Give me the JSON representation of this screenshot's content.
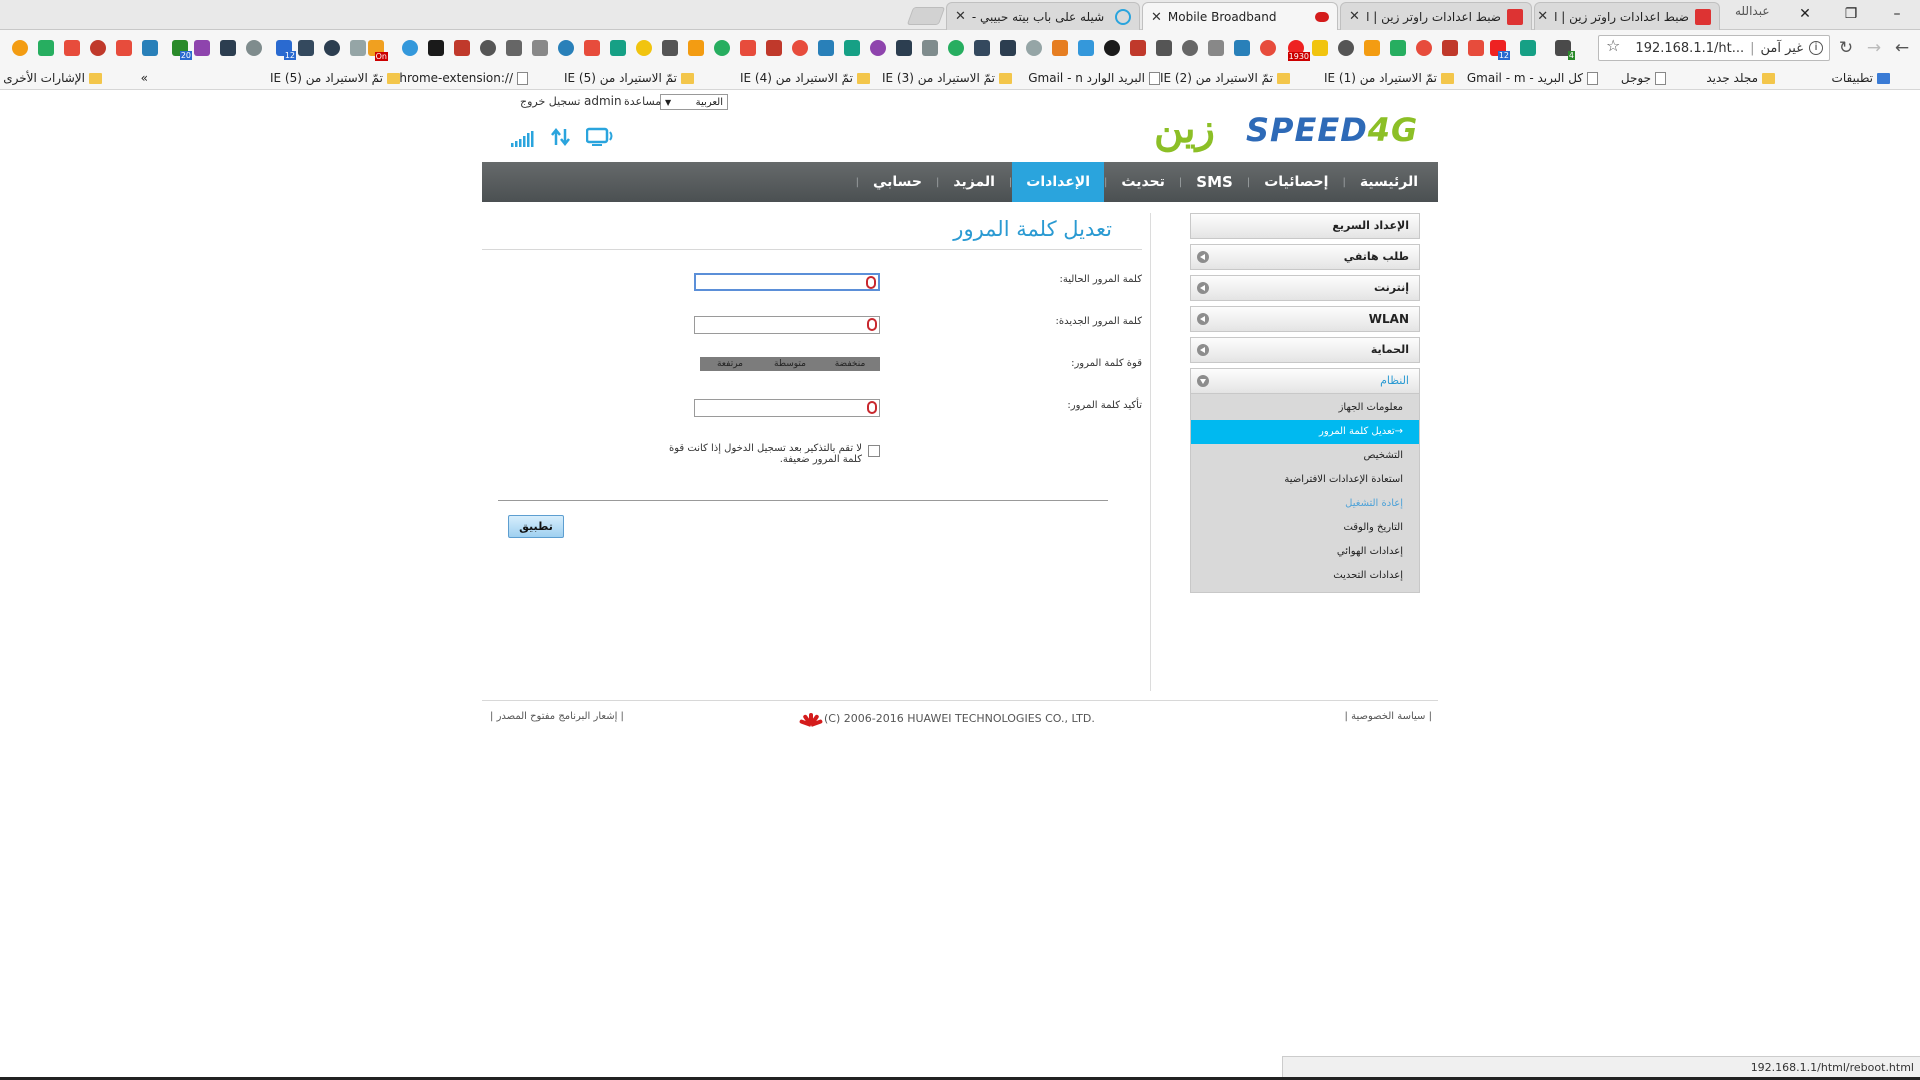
{
  "browser": {
    "profile_name": "عبدالله",
    "tabs": [
      {
        "title": "ضبط اعدادات راوتر زين | ا"
      },
      {
        "title": "ضبط اعدادات راوتر زين | ا"
      },
      {
        "title": "Mobile Broadband"
      },
      {
        "title": "شيله على باب بيته حبيبي -"
      }
    ],
    "omnibox": {
      "security_label": "غير آمن",
      "url": "192.168.1.1/ht..."
    },
    "extension_badges": [
      "20",
      "12",
      "12",
      "4",
      "1930",
      "On"
    ],
    "bookmarks": [
      {
        "label": "تطبيقات"
      },
      {
        "label": "مجلد جديد"
      },
      {
        "label": "جوجل"
      },
      {
        "label": "كل البريد - Gmail - m"
      },
      {
        "label": "تمّ الاستيراد من IE (1)"
      },
      {
        "label": "تمّ الاستيراد من IE (2)"
      },
      {
        "label": "البريد الوارد Gmail - n"
      },
      {
        "label": "تمّ الاستيراد من IE (3)"
      },
      {
        "label": "تمّ الاستيراد من IE (4)"
      },
      {
        "label": "تمّ الاستيراد من IE (5)"
      },
      {
        "label": "//:chrome-extension"
      },
      {
        "label": "تمّ الاستيراد من IE (5)"
      },
      {
        "label": "»"
      },
      {
        "label": "الإشارات الأخرى"
      }
    ],
    "status_url": "192.168.1.1/html/reboot.html"
  },
  "header": {
    "language": "العربية",
    "user": "admin",
    "help": "مساعدة",
    "logout": "تسجيل خروج",
    "logo_zain": "زين",
    "logo_speed": "SPEED",
    "logo_4g": "4G"
  },
  "nav": {
    "items": [
      {
        "label": "الرئيسية"
      },
      {
        "label": "إحصائيات"
      },
      {
        "label": "SMS"
      },
      {
        "label": "تحديث"
      },
      {
        "label": "الإعدادات"
      },
      {
        "label": "المزيد"
      },
      {
        "label": "حسابي"
      }
    ],
    "active_index": 4
  },
  "main": {
    "title": "تعديل كلمة المرور",
    "fields": {
      "current_password_label": "كلمة المرور الحالية:",
      "new_password_label": "كلمة المرور الجديدة:",
      "strength_label": "قوة كلمة المرور:",
      "confirm_password_label": "تأكيد كلمة المرور:"
    },
    "strength_levels": [
      "منخفضة",
      "متوسطة",
      "مرتفعة"
    ],
    "weak_reminder": "لا تقم بالتذكير بعد تسجيل الدخول إذا كانت قوة كلمة المرور ضعيفة.",
    "apply_label": "تطبيق"
  },
  "sidebar": {
    "items": [
      {
        "label": "الإعداد السريع"
      },
      {
        "label": "طلب هاتفي"
      },
      {
        "label": "إنترنت"
      },
      {
        "label": "WLAN"
      },
      {
        "label": "الحماية"
      },
      {
        "label": "النظام"
      }
    ],
    "system_sub": [
      {
        "label": "معلومات الجهاز"
      },
      {
        "label": "تعديل كلمة المرور"
      },
      {
        "label": "التشخيص"
      },
      {
        "label": "استعادة الإعدادات الافتراضية"
      },
      {
        "label": "إعادة التشغيل"
      },
      {
        "label": "التاريخ والوقت"
      },
      {
        "label": "إعدادات الهوائي"
      },
      {
        "label": "إعدادات التحديث"
      }
    ]
  },
  "footer": {
    "privacy": "سياسة الخصوصية",
    "copyright": "(C) 2006-2016 HUAWEI TECHNOLOGIES CO., LTD.",
    "open_source": "إشعار البرنامج مفتوح المصدر"
  },
  "colors": {
    "accent": "#2aa4dd",
    "sidebar_active": "#00b9f0",
    "brand_green": "#8cbf26",
    "brand_blue": "#2e6ab7",
    "nav_bg": "#4b5052"
  }
}
